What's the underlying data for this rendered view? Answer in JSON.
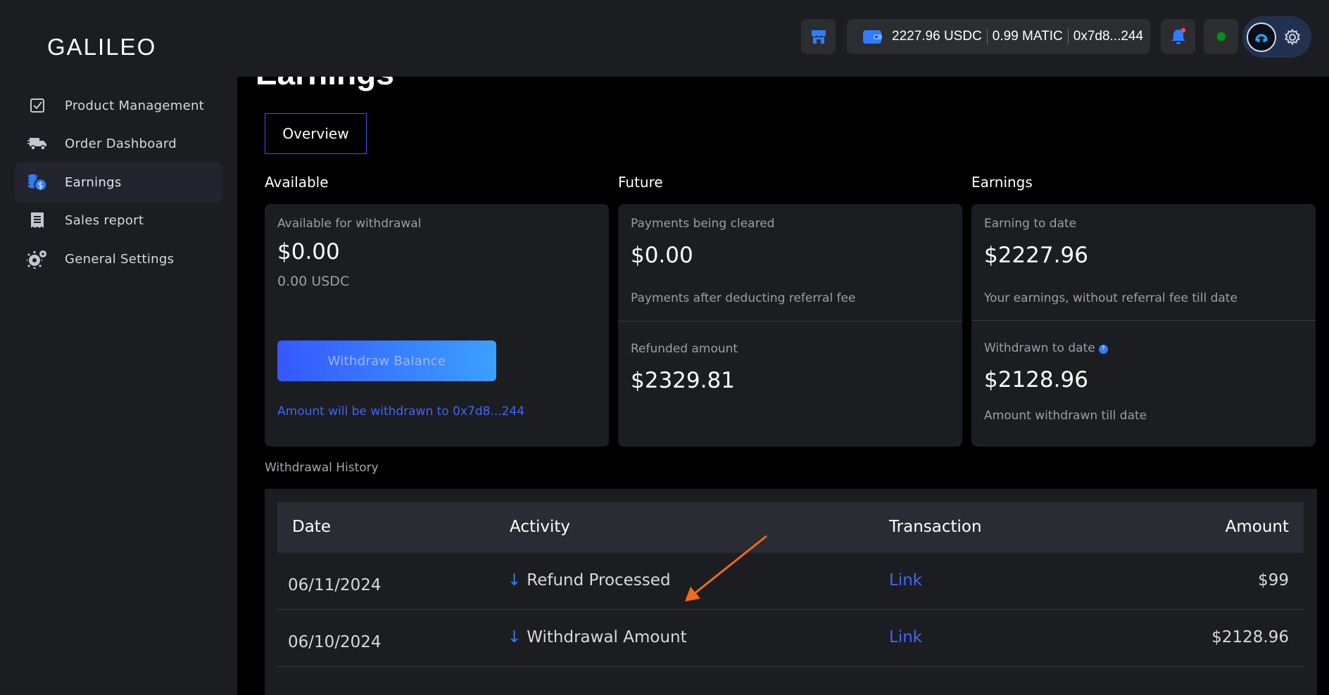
{
  "app": {
    "logo": "GALILEO"
  },
  "topbar": {
    "wallet": {
      "usdc": "2227.96 USDC",
      "matic": "0.99 MATIC",
      "address": "0x7d8...244"
    },
    "colors": {
      "accent": "#2f7dff",
      "status_online": "#0f8a1c",
      "notification_dot": "#ff4a4a"
    }
  },
  "sidebar": {
    "items": [
      {
        "label": "Product Management",
        "icon": "checkbox-icon",
        "active": false
      },
      {
        "label": "Order Dashboard",
        "icon": "delivery-truck-icon",
        "active": false
      },
      {
        "label": "Earnings",
        "icon": "coins-icon",
        "active": true
      },
      {
        "label": "Sales report",
        "icon": "receipt-icon",
        "active": false
      },
      {
        "label": "General Settings",
        "icon": "gears-icon",
        "active": false
      }
    ]
  },
  "main": {
    "title": "Earnings",
    "tab": "Overview",
    "available": {
      "header": "Available",
      "label": "Available for withdrawal",
      "amount": "$0.00",
      "sub": "0.00 USDC",
      "button": "Withdraw Balance",
      "note": "Amount will be withdrawn to 0x7d8...244"
    },
    "future": {
      "header": "Future",
      "cleared_label": "Payments being cleared",
      "cleared_amount": "$0.00",
      "cleared_note": "Payments after deducting referral fee",
      "refunded_label": "Refunded amount",
      "refunded_amount": "$2329.81"
    },
    "earnings": {
      "header": "Earnings",
      "todate_label": "Earning to date",
      "todate_amount": "$2227.96",
      "todate_note": "Your earnings, without referral fee till date",
      "withdrawn_label": "Withdrawn to date",
      "withdrawn_amount": "$2128.96",
      "withdrawn_note": "Amount withdrawn till date"
    },
    "history": {
      "label": "Withdrawal History",
      "columns": {
        "date": "Date",
        "activity": "Activity",
        "transaction": "Transaction",
        "amount": "Amount"
      },
      "rows": [
        {
          "date": "06/11/2024",
          "arrow": "↓",
          "activity": "Refund Processed",
          "transaction": "Link",
          "amount": "$99"
        },
        {
          "date": "06/10/2024",
          "arrow": "↓",
          "activity": "Withdrawal Amount",
          "transaction": "Link",
          "amount": "$2128.96"
        }
      ]
    }
  }
}
